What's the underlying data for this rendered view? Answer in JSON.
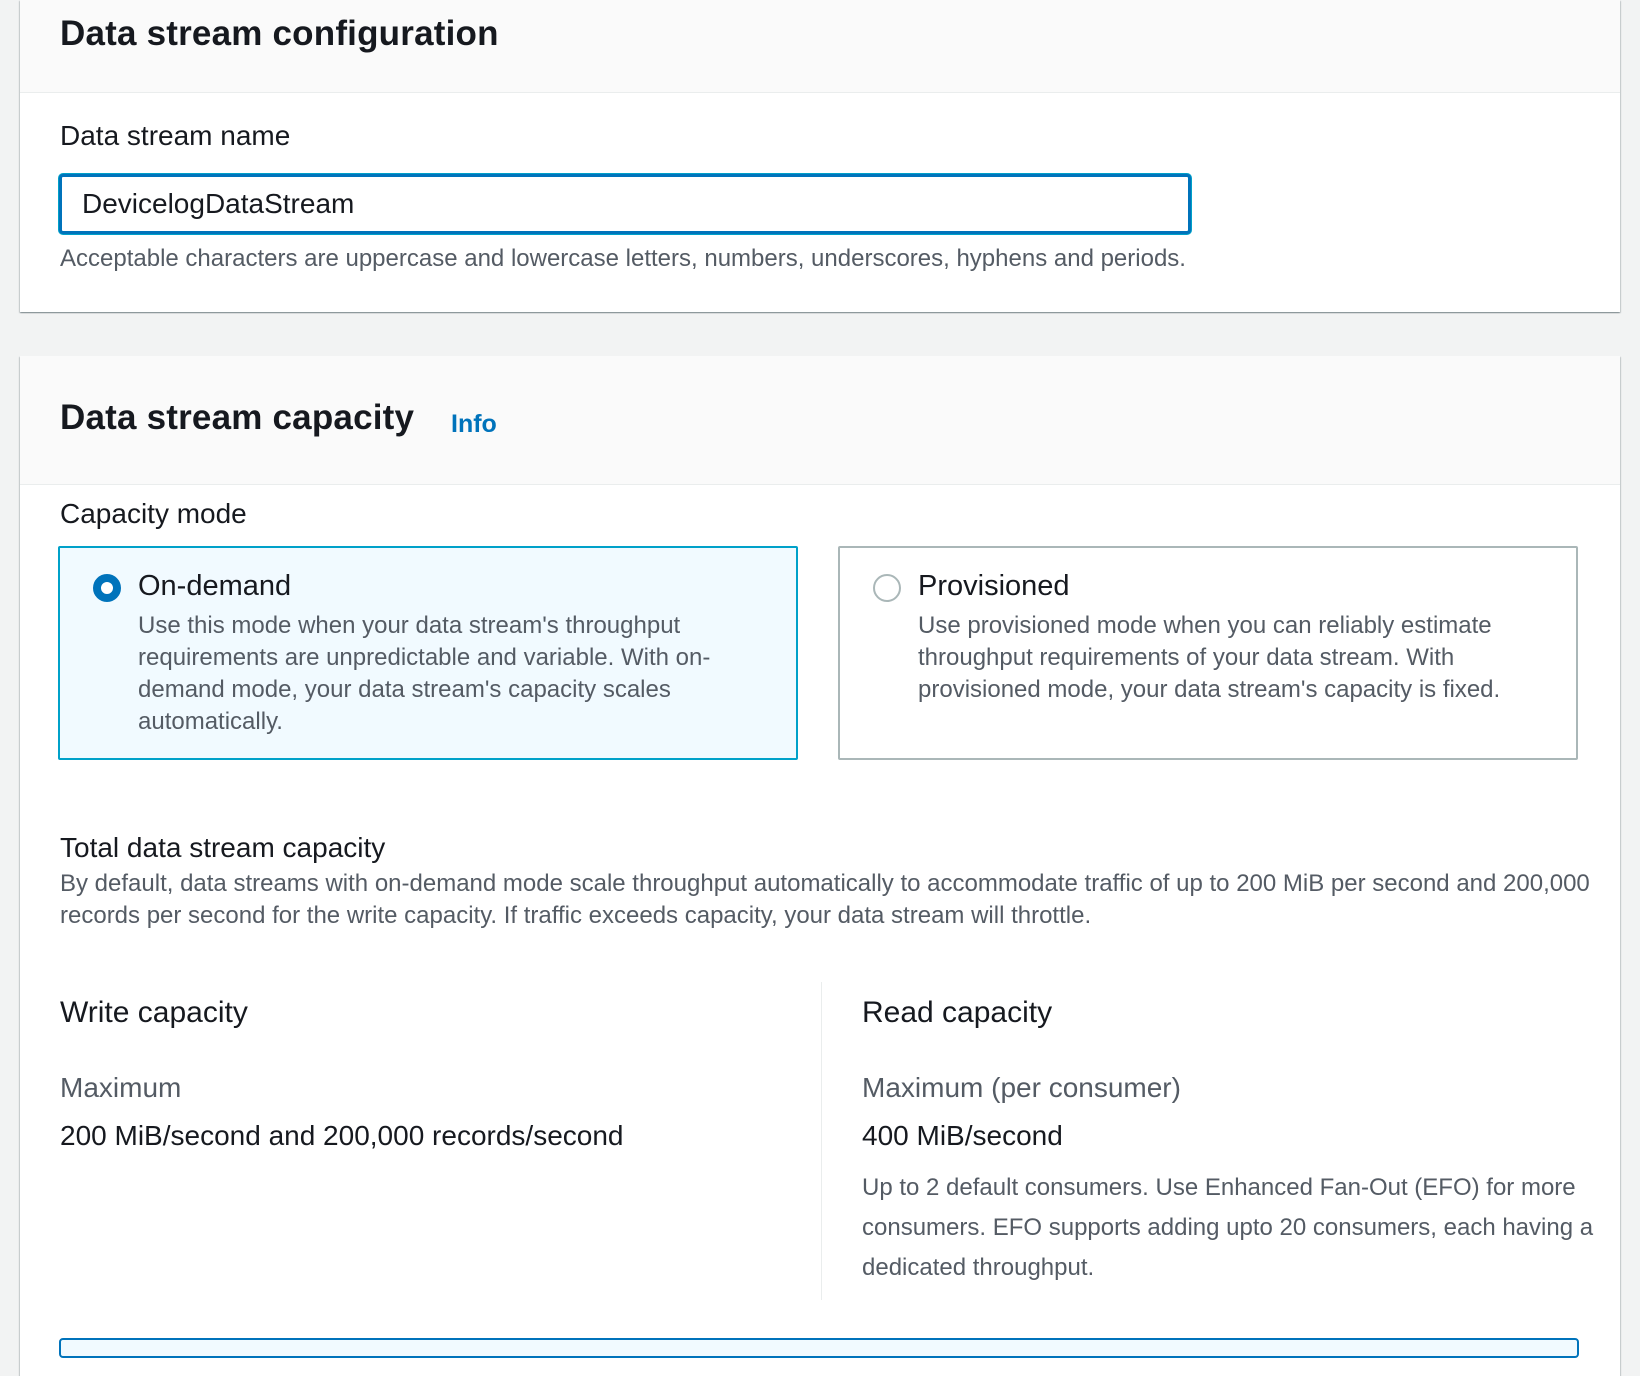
{
  "config_panel": {
    "title": "Data stream configuration",
    "name_label": "Data stream name",
    "name_value": "DevicelogDataStream",
    "name_hint": "Acceptable characters are uppercase and lowercase letters, numbers, underscores, hyphens and periods."
  },
  "capacity_panel": {
    "title": "Data stream capacity",
    "info_link": "Info",
    "mode_label": "Capacity mode",
    "modes": [
      {
        "title": "On-demand",
        "description": "Use this mode when your data stream's throughput requirements are unpredictable and variable. With on-demand mode, your data stream's capacity scales automatically.",
        "selected": true
      },
      {
        "title": "Provisioned",
        "description": "Use provisioned mode when you can reliably estimate throughput requirements of your data stream. With provisioned mode, your data stream's capacity is fixed.",
        "selected": false
      }
    ],
    "total": {
      "label": "Total data stream capacity",
      "description": "By default, data streams with on-demand mode scale throughput automatically to accommodate traffic of up to 200 MiB per second and 200,000 records per second for the write capacity. If traffic exceeds capacity, your data stream will throttle."
    },
    "write": {
      "title": "Write capacity",
      "key": "Maximum",
      "value": "200 MiB/second and 200,000 records/second"
    },
    "read": {
      "title": "Read capacity",
      "key": "Maximum (per consumer)",
      "value": "400 MiB/second",
      "note": "Up to 2 default consumers. Use Enhanced Fan-Out (EFO) for more consumers. EFO supports adding upto 20 consumers, each having a dedicated throughput."
    }
  },
  "colors": {
    "accent": "#0073bb",
    "focus": "#00a1c9",
    "selected_bg": "#f1faff",
    "page_bg": "#f2f3f3"
  }
}
